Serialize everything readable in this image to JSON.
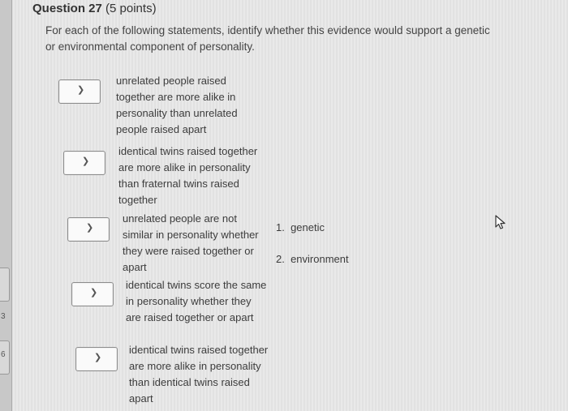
{
  "question": {
    "title": "Question 27",
    "points": "(5 points)",
    "prompt": "For each of the following statements, identify whether this evidence would support a genetic or environmental component of personality."
  },
  "statements": [
    {
      "text": "unrelated people raised together are more alike in personality than unrelated people raised apart",
      "selected": ""
    },
    {
      "text": "identical twins raised together are more alike in personality than fraternal twins raised together",
      "selected": ""
    },
    {
      "text": "unrelated people are not similar in personality whether they were raised together or apart",
      "selected": ""
    },
    {
      "text": "identical twins score the same in personality whether they are raised together or apart",
      "selected": ""
    },
    {
      "text": "identical twins raised together are more alike in personality than identical twins raised apart",
      "selected": ""
    }
  ],
  "options": [
    {
      "number": "1.",
      "label": "genetic"
    },
    {
      "number": "2.",
      "label": "environment"
    }
  ],
  "icons": {
    "dropdown": "chevron-down-icon",
    "cursor": "pointer-cursor-icon"
  },
  "left_strip_marks": [
    "3",
    "6"
  ]
}
